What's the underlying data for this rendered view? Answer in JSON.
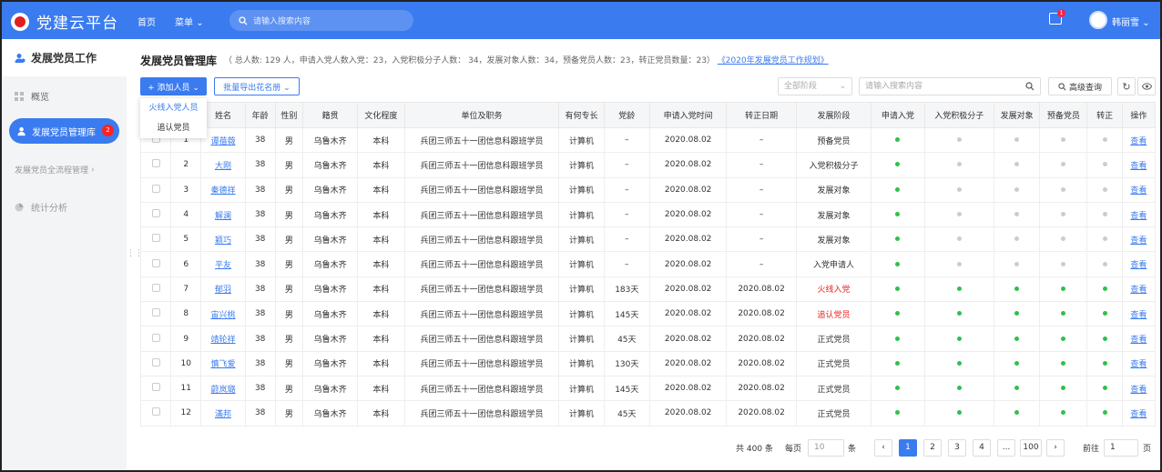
{
  "app": {
    "title": "党建云平台"
  },
  "topnav": {
    "home": "首页",
    "menu": "菜单",
    "search_placeholder": "请输入搜索内容",
    "msg_badge": "1",
    "user": "韩丽雪"
  },
  "sidebar": {
    "header": "发展党员工作",
    "items": [
      {
        "label": "概览"
      },
      {
        "label": "发展党员管理库",
        "badge": "2"
      },
      {
        "label": "发展党员全流程管理"
      },
      {
        "label": "统计分析"
      }
    ]
  },
  "main": {
    "title": "发展党员管理库",
    "summary": "（ 总人数: 129 人，申请入党人数入党：23，入党积极分子人数： 34，发展对象人数：34，预备党员人数：23，转正党员数量：23）",
    "plan_link": "《2020年发展党员工作规划》",
    "add_button": "+ 添加人员 ⌄",
    "export_button": "批量导出花名册 ⌄",
    "dropdown": [
      "火线入党人员",
      "追认党员"
    ],
    "stage_select": "全部阶段",
    "keyword_placeholder": "请输入搜索内容",
    "advanced": "高级查询"
  },
  "table": {
    "headers": [
      "",
      "",
      "姓名",
      "年龄",
      "性别",
      "籍贯",
      "文化程度",
      "单位及职务",
      "有何专长",
      "党龄",
      "申请入党时间",
      "转正日期",
      "发展阶段",
      "申请入党",
      "入党积极分子",
      "发展对象",
      "预备党员",
      "转正",
      "操作"
    ],
    "rows": [
      {
        "no": "1",
        "name": "谭蓓薇",
        "age": "38",
        "sex": "男",
        "origin": "乌鲁木齐",
        "edu": "本科",
        "unit": "兵团三师五十一团信息科跟班学员",
        "skill": "计算机",
        "party_age": "–",
        "apply": "2020.08.02",
        "regular": "–",
        "stage": "预备党员",
        "red": false,
        "dots": [
          1,
          0,
          0,
          0,
          0
        ],
        "op": "查看"
      },
      {
        "no": "2",
        "name": "大刚",
        "age": "38",
        "sex": "男",
        "origin": "乌鲁木齐",
        "edu": "本科",
        "unit": "兵团三师五十一团信息科跟班学员",
        "skill": "计算机",
        "party_age": "–",
        "apply": "2020.08.02",
        "regular": "–",
        "stage": "入党积极分子",
        "red": false,
        "dots": [
          1,
          0,
          0,
          0,
          0
        ],
        "op": "查看"
      },
      {
        "no": "3",
        "name": "秦德祥",
        "age": "38",
        "sex": "男",
        "origin": "乌鲁木齐",
        "edu": "本科",
        "unit": "兵团三师五十一团信息科跟班学员",
        "skill": "计算机",
        "party_age": "–",
        "apply": "2020.08.02",
        "regular": "–",
        "stage": "发展对象",
        "red": false,
        "dots": [
          1,
          0,
          0,
          0,
          0
        ],
        "op": "查看"
      },
      {
        "no": "4",
        "name": "解澜",
        "age": "38",
        "sex": "男",
        "origin": "乌鲁木齐",
        "edu": "本科",
        "unit": "兵团三师五十一团信息科跟班学员",
        "skill": "计算机",
        "party_age": "–",
        "apply": "2020.08.02",
        "regular": "–",
        "stage": "发展对象",
        "red": false,
        "dots": [
          1,
          0,
          0,
          0,
          0
        ],
        "op": "查看"
      },
      {
        "no": "5",
        "name": "颖巧",
        "age": "38",
        "sex": "男",
        "origin": "乌鲁木齐",
        "edu": "本科",
        "unit": "兵团三师五十一团信息科跟班学员",
        "skill": "计算机",
        "party_age": "–",
        "apply": "2020.08.02",
        "regular": "–",
        "stage": "发展对象",
        "red": false,
        "dots": [
          1,
          0,
          0,
          0,
          0
        ],
        "op": "查看"
      },
      {
        "no": "6",
        "name": "平友",
        "age": "38",
        "sex": "男",
        "origin": "乌鲁木齐",
        "edu": "本科",
        "unit": "兵团三师五十一团信息科跟班学员",
        "skill": "计算机",
        "party_age": "–",
        "apply": "2020.08.02",
        "regular": "–",
        "stage": "入党申请人",
        "red": false,
        "dots": [
          1,
          0,
          0,
          0,
          0
        ],
        "op": "查看"
      },
      {
        "no": "7",
        "name": "郁羽",
        "age": "38",
        "sex": "男",
        "origin": "乌鲁木齐",
        "edu": "本科",
        "unit": "兵团三师五十一团信息科跟班学员",
        "skill": "计算机",
        "party_age": "183天",
        "apply": "2020.08.02",
        "regular": "2020.08.02",
        "stage": "火线入党",
        "red": true,
        "dots": [
          1,
          1,
          1,
          1,
          1
        ],
        "op": "查看"
      },
      {
        "no": "8",
        "name": "宙兴桃",
        "age": "38",
        "sex": "男",
        "origin": "乌鲁木齐",
        "edu": "本科",
        "unit": "兵团三师五十一团信息科跟班学员",
        "skill": "计算机",
        "party_age": "145天",
        "apply": "2020.08.02",
        "regular": "2020.08.02",
        "stage": "追认党员",
        "red": true,
        "dots": [
          1,
          1,
          1,
          1,
          1
        ],
        "op": "查看"
      },
      {
        "no": "9",
        "name": "靖轮祥",
        "age": "38",
        "sex": "男",
        "origin": "乌鲁木齐",
        "edu": "本科",
        "unit": "兵团三师五十一团信息科跟班学员",
        "skill": "计算机",
        "party_age": "45天",
        "apply": "2020.08.02",
        "regular": "2020.08.02",
        "stage": "正式党员",
        "red": false,
        "dots": [
          1,
          1,
          1,
          1,
          1
        ],
        "op": "查看"
      },
      {
        "no": "10",
        "name": "慎飞爱",
        "age": "38",
        "sex": "男",
        "origin": "乌鲁木齐",
        "edu": "本科",
        "unit": "兵团三师五十一团信息科跟班学员",
        "skill": "计算机",
        "party_age": "130天",
        "apply": "2020.08.02",
        "regular": "2020.08.02",
        "stage": "正式党员",
        "red": false,
        "dots": [
          1,
          1,
          1,
          1,
          1
        ],
        "op": "查看"
      },
      {
        "no": "11",
        "name": "蔚岚璐",
        "age": "38",
        "sex": "男",
        "origin": "乌鲁木齐",
        "edu": "本科",
        "unit": "兵团三师五十一团信息科跟班学员",
        "skill": "计算机",
        "party_age": "145天",
        "apply": "2020.08.02",
        "regular": "2020.08.02",
        "stage": "正式党员",
        "red": false,
        "dots": [
          1,
          1,
          1,
          1,
          1
        ],
        "op": "查看"
      },
      {
        "no": "12",
        "name": "滿邦",
        "age": "38",
        "sex": "男",
        "origin": "乌鲁木齐",
        "edu": "本科",
        "unit": "兵团三师五十一团信息科跟班学员",
        "skill": "计算机",
        "party_age": "45天",
        "apply": "2020.08.02",
        "regular": "2020.08.02",
        "stage": "正式党员",
        "red": false,
        "dots": [
          1,
          1,
          1,
          1,
          1
        ],
        "op": "查看"
      }
    ]
  },
  "pagination": {
    "total": "共 400 条",
    "per_page_label": "每页",
    "per_page": "10",
    "per_page_unit": "条",
    "prev": "‹",
    "pages": [
      "1",
      "2",
      "3",
      "4",
      "...",
      "100"
    ],
    "next": "›",
    "goto_label": "前往",
    "goto_value": "1",
    "goto_unit": "页"
  },
  "colors": {
    "primary": "#3a7bf0",
    "green_dot": "#2fc14a",
    "grey_dot": "#cccccc",
    "red": "#ee2222"
  }
}
